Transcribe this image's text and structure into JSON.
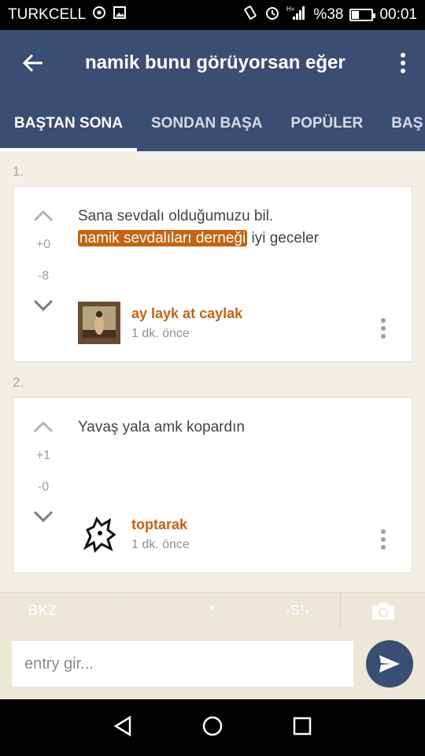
{
  "status_bar": {
    "carrier": "TURKCELL",
    "battery_text": "%38",
    "battery_level": 0.38,
    "network": "H+",
    "time": "00:01",
    "icons": [
      "whatsapp-icon",
      "image-icon",
      "vibrate-icon",
      "alarm-icon",
      "signal-icon",
      "battery-icon"
    ]
  },
  "app_bar": {
    "title": "namik bunu görüyorsan eğer"
  },
  "tabs": [
    {
      "label": "BAŞTAN SONA",
      "active": true
    },
    {
      "label": "SONDAN BAŞA",
      "active": false
    },
    {
      "label": "POPÜLER",
      "active": false
    },
    {
      "label": "BAŞ",
      "active": false
    }
  ],
  "entries": [
    {
      "number": "1.",
      "upvotes": "+0",
      "downvotes": "-8",
      "text_before": "Sana sevdalı olduğumuzu bil.",
      "link": "namik sevdalıları derneği",
      "text_after": " iyi geceler",
      "author": "ay layk at caylak",
      "time": "1 dk. önce"
    },
    {
      "number": "2.",
      "upvotes": "+1",
      "downvotes": "-0",
      "text": "Yavaş yala amk kopardın",
      "author": "toptarak",
      "time": "1 dk. önce"
    }
  ],
  "toolbar": {
    "bkz": "BKZ",
    "backtick": "``",
    "star": "*",
    "spoiler": "-S!-"
  },
  "input": {
    "placeholder": "entry gir..."
  },
  "colors": {
    "primary": "#3a4d72",
    "accent": "#c46412",
    "background": "#f2efe6"
  }
}
